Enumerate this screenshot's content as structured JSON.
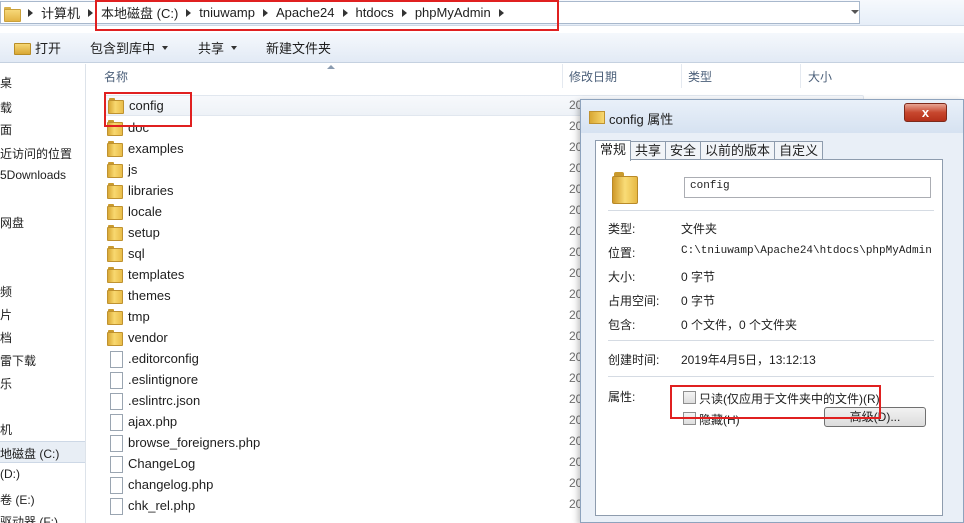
{
  "address_bar": {
    "crumbs": [
      "计算机",
      "本地磁盘 (C:)",
      "tniuwamp",
      "Apache24",
      "htdocs",
      "phpMyAdmin"
    ]
  },
  "toolbar": {
    "open_label": "打开",
    "include_label": "包含到库中",
    "share_label": "共享",
    "new_folder_label": "新建文件夹"
  },
  "nav": {
    "items": [
      "桌",
      "载",
      "面",
      "近访问的位置",
      "5Downloads",
      "网盘",
      "频",
      "片",
      "档",
      "雷下载",
      "乐",
      "机",
      "地磁盘 (C:)",
      "(D:)",
      "卷 (E:)",
      "驱动器 (F:)"
    ]
  },
  "columns": {
    "name": "名称",
    "modified": "修改日期",
    "type": "类型",
    "size": "大小"
  },
  "files": [
    {
      "name": "config",
      "kind": "folder",
      "date_stub": "20"
    },
    {
      "name": "doc",
      "kind": "folder",
      "date_stub": "20"
    },
    {
      "name": "examples",
      "kind": "folder",
      "date_stub": "20"
    },
    {
      "name": "js",
      "kind": "folder",
      "date_stub": "20"
    },
    {
      "name": "libraries",
      "kind": "folder",
      "date_stub": "20"
    },
    {
      "name": "locale",
      "kind": "folder",
      "date_stub": "20"
    },
    {
      "name": "setup",
      "kind": "folder",
      "date_stub": "20"
    },
    {
      "name": "sql",
      "kind": "folder",
      "date_stub": "20"
    },
    {
      "name": "templates",
      "kind": "folder",
      "date_stub": "20"
    },
    {
      "name": "themes",
      "kind": "folder",
      "date_stub": "20"
    },
    {
      "name": "tmp",
      "kind": "folder",
      "date_stub": "20"
    },
    {
      "name": "vendor",
      "kind": "folder",
      "date_stub": "20"
    },
    {
      "name": ".editorconfig",
      "kind": "file",
      "date_stub": "20"
    },
    {
      "name": ".eslintignore",
      "kind": "file",
      "date_stub": "20"
    },
    {
      "name": ".eslintrc.json",
      "kind": "file",
      "date_stub": "20"
    },
    {
      "name": "ajax.php",
      "kind": "file",
      "date_stub": "20"
    },
    {
      "name": "browse_foreigners.php",
      "kind": "file",
      "date_stub": "20"
    },
    {
      "name": "ChangeLog",
      "kind": "file",
      "date_stub": "20"
    },
    {
      "name": "changelog.php",
      "kind": "file",
      "date_stub": "20"
    },
    {
      "name": "chk_rel.php",
      "kind": "file",
      "date_stub": "20"
    }
  ],
  "dialog": {
    "title": "config 属性",
    "close": "x",
    "tabs": [
      "常规",
      "共享",
      "安全",
      "以前的版本",
      "自定义"
    ],
    "active_tab": "常规",
    "folder_name": "config",
    "props": {
      "type_label": "类型:",
      "type_value": "文件夹",
      "location_label": "位置:",
      "location_value": "C:\\tniuwamp\\Apache24\\htdocs\\phpMyAdmin",
      "size_label": "大小:",
      "size_value": "0 字节",
      "disk_label": "占用空间:",
      "disk_value": "0 字节",
      "contains_label": "包含:",
      "contains_value": "0 个文件，0 个文件夹",
      "created_label": "创建时间:",
      "created_value": "2019年4月5日，13:12:13",
      "attrs_label": "属性:",
      "readonly_label": "只读(仅应用于文件夹中的文件)(R)",
      "hidden_label": "隐藏(H)",
      "advanced_label": "高级(D)..."
    }
  }
}
